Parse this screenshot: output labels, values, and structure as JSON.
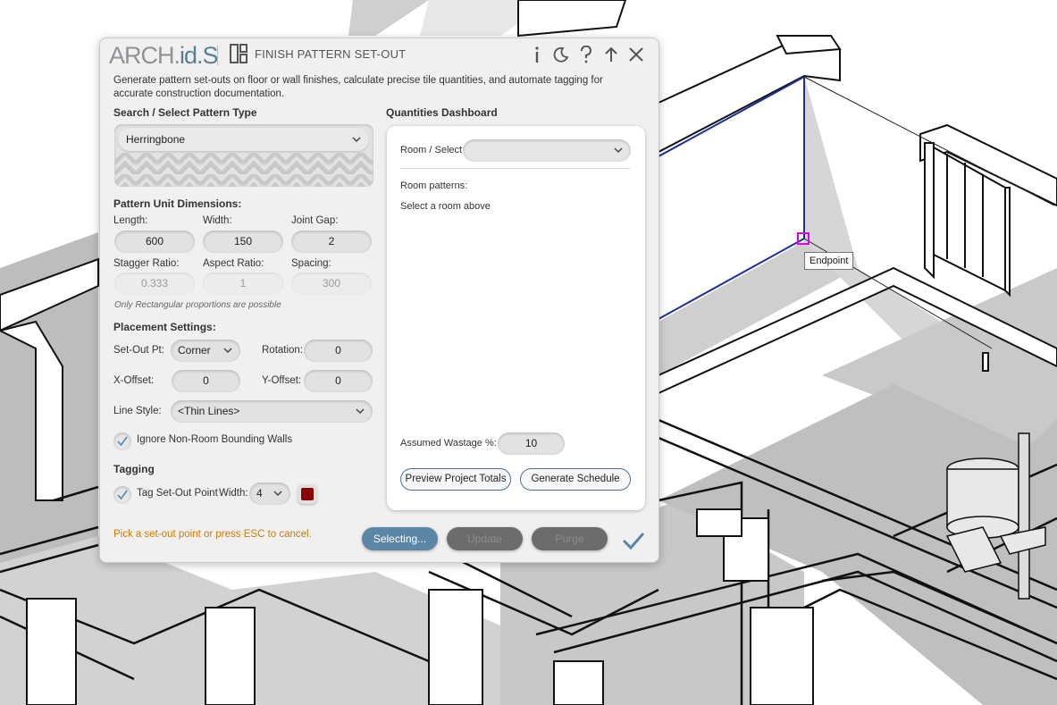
{
  "viewport": {
    "tooltip": "Endpoint"
  },
  "dialog": {
    "logo_prefix": "ARCH.",
    "logo_ids": "id.S",
    "title": "FINISH PATTERN SET-OUT",
    "titlebar_buttons": [
      "i",
      "moon",
      "?",
      "up-arrow",
      "close"
    ],
    "description": "Generate pattern set-outs on floor or wall finishes, calculate precise tile quantities, and automate tagging for accurate construction documentation.",
    "pattern_section": {
      "label": "Search / Select Pattern Type",
      "selected": "Herringbone"
    },
    "dimensions": {
      "label": "Pattern Unit Dimensions:",
      "length_label": "Length:",
      "length": "600",
      "width_label": "Width:",
      "width": "150",
      "joint_gap_label": "Joint Gap:",
      "joint_gap": "2",
      "stagger_label": "Stagger Ratio:",
      "stagger": "0.333",
      "aspect_label": "Aspect Ratio:",
      "aspect": "1",
      "spacing_label": "Spacing:",
      "spacing": "300",
      "note": "Only Rectangular proportions are possible"
    },
    "placement": {
      "label": "Placement Settings:",
      "setout_label": "Set-Out Pt:",
      "setout": "Corner",
      "rotation_label": "Rotation:",
      "rotation": "0",
      "xoffset_label": "X-Offset:",
      "xoffset": "0",
      "yoffset_label": "Y-Offset:",
      "yoffset": "0",
      "linestyle_label": "Line Style:",
      "linestyle": "<Thin Lines>",
      "ignore_walls_label": "Ignore Non-Room Bounding Walls",
      "ignore_walls_checked": true
    },
    "tagging": {
      "label": "Tagging",
      "tag_label": "Tag Set-Out Point",
      "tag_checked": true,
      "width_label": "Width:",
      "width": "4",
      "tag_color": "#8b0000"
    },
    "dashboard": {
      "label": "Quantities Dashboard",
      "room_select_label": "Room / Select",
      "room_select_value": "",
      "room_patterns_label": "Room patterns:",
      "room_patterns_message": "Select a room above",
      "wastage_label": "Assumed Wastage %:",
      "wastage": "10",
      "preview_button": "Preview Project Totals",
      "schedule_button": "Generate Schedule"
    },
    "status_message": "Pick a set-out point or press ESC to cancel.",
    "buttons": {
      "selecting": "Selecting...",
      "update": "Update",
      "purge": "Purge"
    },
    "colors": {
      "accent": "#5a84a8",
      "status": "#d07a00",
      "button_active": "#5c86a6",
      "button_disabled": "#6c6c6c"
    }
  }
}
